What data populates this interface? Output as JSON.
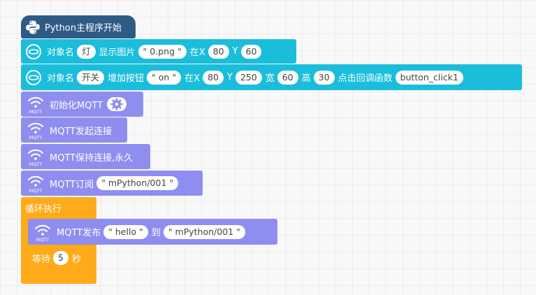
{
  "main_start": {
    "label": "Python主程序开始"
  },
  "image_block": {
    "obj_label": "对象名",
    "obj_value": "灯",
    "action": "显示图片",
    "filename": "0.png",
    "x_label": "在X",
    "x_value": "80",
    "y_label": "Y",
    "y_value": "60"
  },
  "button_block": {
    "obj_label": "对象名",
    "obj_value": "开关",
    "action": "增加按钮",
    "text": "on",
    "x_label": "在X",
    "x_value": "80",
    "y_label": "Y",
    "y_value": "250",
    "w_label": "宽",
    "w_value": "60",
    "h_label": "高",
    "h_value": "30",
    "cb_label": "点击回调函数",
    "cb_value": "button_click1"
  },
  "mqtt_init": {
    "label": "初始化MQTT"
  },
  "mqtt_connect": {
    "label": "MQTT发起连接"
  },
  "mqtt_keep": {
    "label": "MQTT保持连接,永久"
  },
  "mqtt_subscribe": {
    "label": "MQTT订阅",
    "topic": "mPython/001"
  },
  "loop": {
    "label": "循环执行"
  },
  "publish": {
    "label": "MQTT发布",
    "message": "hello",
    "to_label": "到",
    "topic": "mPython/001"
  },
  "wait": {
    "label": "等待",
    "value": "5",
    "unit": "秒"
  },
  "mqtt_icon_text": "MQTT",
  "colors": {
    "python": "#2f5a86",
    "screen": "#1abedb",
    "mqtt": "#8e8ef0",
    "control": "#ffab19"
  }
}
